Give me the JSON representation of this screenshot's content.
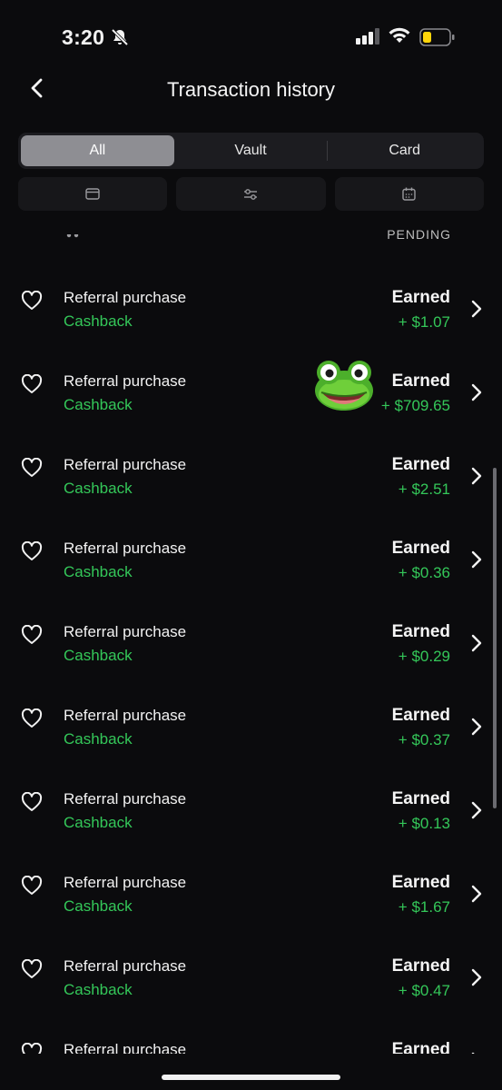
{
  "status_bar": {
    "time": "3:20"
  },
  "header": {
    "title": "Transaction history"
  },
  "tabs": [
    {
      "label": "All",
      "active": true
    },
    {
      "label": "Vault",
      "active": false
    },
    {
      "label": "Card",
      "active": false
    }
  ],
  "filters": [
    {
      "icon": "card-icon"
    },
    {
      "icon": "sliders-icon"
    },
    {
      "icon": "calendar-icon"
    }
  ],
  "peek_row": {
    "status": "PENDING"
  },
  "transactions": [
    {
      "name": "Referral purchase",
      "category": "Cashback",
      "status": "Earned",
      "amount": "+ $1.07"
    },
    {
      "name": "Referral purchase",
      "category": "Cashback",
      "status": "Earned",
      "amount": "+ $709.65"
    },
    {
      "name": "Referral purchase",
      "category": "Cashback",
      "status": "Earned",
      "amount": "+ $2.51"
    },
    {
      "name": "Referral purchase",
      "category": "Cashback",
      "status": "Earned",
      "amount": "+ $0.36"
    },
    {
      "name": "Referral purchase",
      "category": "Cashback",
      "status": "Earned",
      "amount": "+ $0.29"
    },
    {
      "name": "Referral purchase",
      "category": "Cashback",
      "status": "Earned",
      "amount": "+ $0.37"
    },
    {
      "name": "Referral purchase",
      "category": "Cashback",
      "status": "Earned",
      "amount": "+ $0.13"
    },
    {
      "name": "Referral purchase",
      "category": "Cashback",
      "status": "Earned",
      "amount": "+ $1.67"
    },
    {
      "name": "Referral purchase",
      "category": "Cashback",
      "status": "Earned",
      "amount": "+ $0.47"
    },
    {
      "name": "Referral purchase",
      "category": "",
      "status": "Earned",
      "amount": ""
    }
  ],
  "colors": {
    "background": "#0b0b0d",
    "accent_green": "#34c759",
    "segment_active": "#8e8e93",
    "battery_low": "#ffd60a"
  }
}
